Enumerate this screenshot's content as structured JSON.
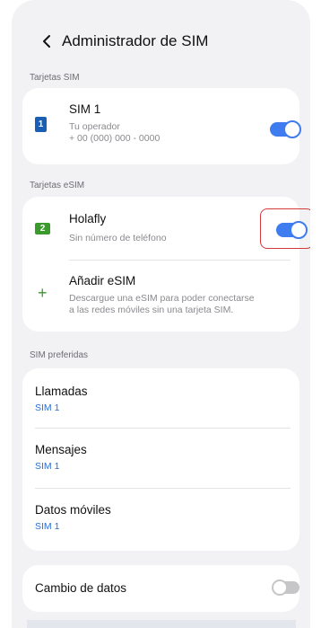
{
  "header": {
    "title": "Administrador de SIM",
    "back_icon": "chevron-left-icon"
  },
  "sections": {
    "sim_cards": "Tarjetas SIM",
    "esim_cards": "Tarjetas eSIM",
    "preferred": "SIM preferidas"
  },
  "sim1": {
    "badge": "1",
    "title": "SIM 1",
    "carrier": "Tu operador",
    "number": "+ 00 (000) 000 - 0000",
    "toggle_on": true
  },
  "esim": {
    "badge": "2",
    "title": "Holafly",
    "sub": "Sin número de teléfono",
    "toggle_on": true
  },
  "add_esim": {
    "icon": "plus-icon",
    "title": "Añadir eSIM",
    "desc_line1": "Descargue una eSIM para poder conectarse",
    "desc_line2": "a las redes móviles sin una tarjeta SIM."
  },
  "preferred": {
    "calls": {
      "label": "Llamadas",
      "value": "SIM 1"
    },
    "messages": {
      "label": "Mensajes",
      "value": "SIM 1"
    },
    "data": {
      "label": "Datos móviles",
      "value": "SIM 1"
    }
  },
  "data_switch": {
    "label": "Cambio de datos",
    "toggle_on": false
  },
  "colors": {
    "accent": "#3e7cf0",
    "highlight": "#d43a3a",
    "sim1_badge": "#1a5fb4",
    "esim_badge": "#3a9a2c",
    "link": "#2a6fd6"
  }
}
